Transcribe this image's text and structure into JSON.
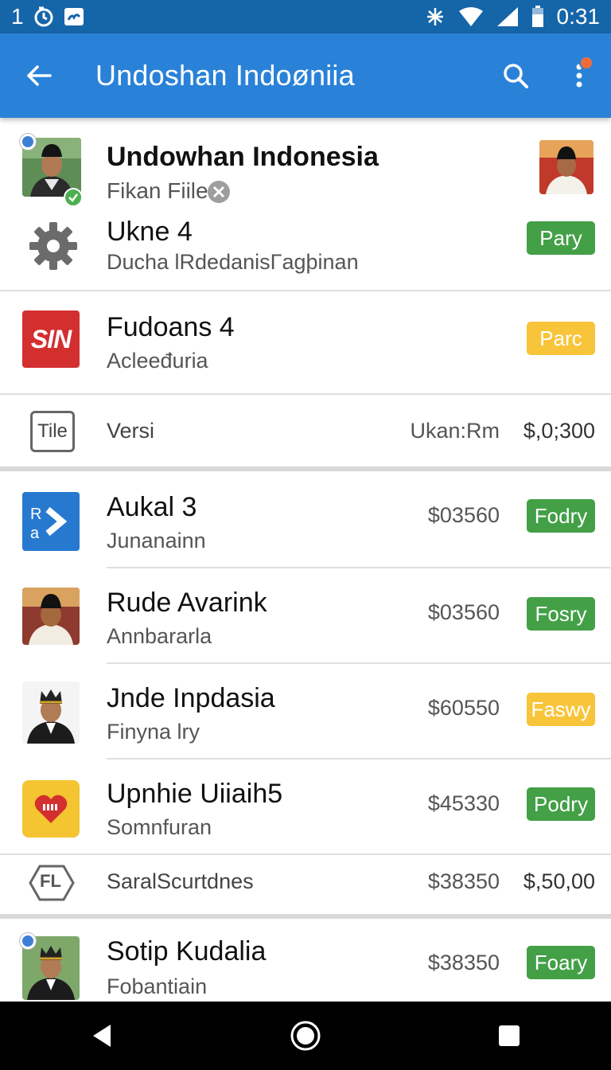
{
  "status_bar": {
    "left_number": "1",
    "time": "0:31",
    "icons": [
      "clock-icon",
      "image-icon",
      "vibrate-icon",
      "wifi-icon",
      "signal-icon",
      "battery-icon"
    ]
  },
  "app_bar": {
    "title": "Undoshan Indoøniia",
    "back_icon": "arrow-left-icon",
    "search_icon": "search-icon",
    "more_icon": "more-vert-icon",
    "color": "#2a82d8"
  },
  "header_item": {
    "title": "Undowhan Indonesia",
    "subtitle": "Fikan Fiile",
    "clear_icon": "close-circle-icon"
  },
  "items": [
    {
      "title": "Ukne 4",
      "subtitle": "Ducha lRdedanisΓagþinan",
      "badge": "Pary",
      "badge_color": "green",
      "icon": "gear-icon"
    },
    {
      "title": "Fudoans 4",
      "subtitle": "Acleeđuria",
      "badge": "Parc",
      "badge_color": "yellow",
      "icon": "sin-logo-icon",
      "logo_text": "SIN"
    }
  ],
  "tile_row": {
    "icon_label": "Tile",
    "label": "Versi",
    "mid": "Ukan:Rm",
    "value": "$,0;300"
  },
  "products": [
    {
      "title": "Aukal 3",
      "subtitle": "Junanainn",
      "price": "$03560",
      "badge": "Fodry",
      "badge_color": "green",
      "icon": "ra-arrow-icon",
      "icon_letters": [
        "R",
        "a"
      ]
    },
    {
      "title": "Rude Avarink",
      "subtitle": "Annbararla",
      "price": "$03560",
      "badge": "Fosry",
      "badge_color": "green",
      "icon": "person-avatar"
    },
    {
      "title": "Jnde Inpdasia",
      "subtitle": "Finyna lry",
      "price": "$60550",
      "badge": "Faswy",
      "badge_color": "yellow",
      "icon": "person-avatar"
    },
    {
      "title": "Upnhie Uiiaih5",
      "subtitle": "Somnfuran",
      "price": "$45330",
      "badge": "Podry",
      "badge_color": "green",
      "icon": "heart-icon"
    }
  ],
  "fl_row": {
    "icon_label": "FL",
    "label": "SaralScurtdnes",
    "price": "$38350",
    "value": "$,50,00"
  },
  "last_item": {
    "title": "Sotip Kudalia",
    "subtitle": "Fobantiain",
    "price": "$38350",
    "badge": "Foary",
    "badge_color": "green"
  },
  "nav_bar": {
    "back": "nav-back-icon",
    "home": "nav-home-icon",
    "recents": "nav-recents-icon"
  }
}
